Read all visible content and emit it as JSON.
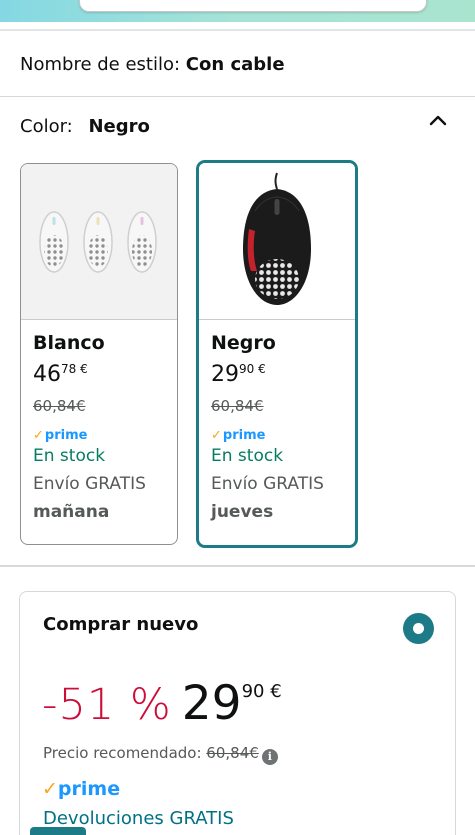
{
  "style": {
    "label": "Nombre de estilo:",
    "value": "Con cable"
  },
  "color": {
    "label": "Color:",
    "value": "Negro",
    "expanded_icon": "chevron-up-icon"
  },
  "variants": [
    {
      "name": "Blanco",
      "price_int": "46",
      "price_dec": "78 €",
      "list_price": "60,84€",
      "prime": "prime",
      "stock": "En stock",
      "shipping": "Envío GRATIS",
      "delivery": "mañana"
    },
    {
      "name": "Negro",
      "price_int": "29",
      "price_dec": "90 €",
      "list_price": "60,84€",
      "prime": "prime",
      "stock": "En stock",
      "shipping": "Envío GRATIS",
      "delivery": "jueves"
    }
  ],
  "buy": {
    "title": "Comprar nuevo",
    "discount": "-51 %",
    "price_int": "29",
    "price_dec": "90 €",
    "recommended_label": "Precio recomendado:",
    "recommended_price": "60,84€",
    "prime": "prime",
    "returns": "Devoluciones GRATIS"
  },
  "colors": {
    "accent": "#1d7a87",
    "deal": "#cc0c39",
    "stock": "#067d62",
    "prime": "#1a98ff",
    "link": "#007185"
  }
}
